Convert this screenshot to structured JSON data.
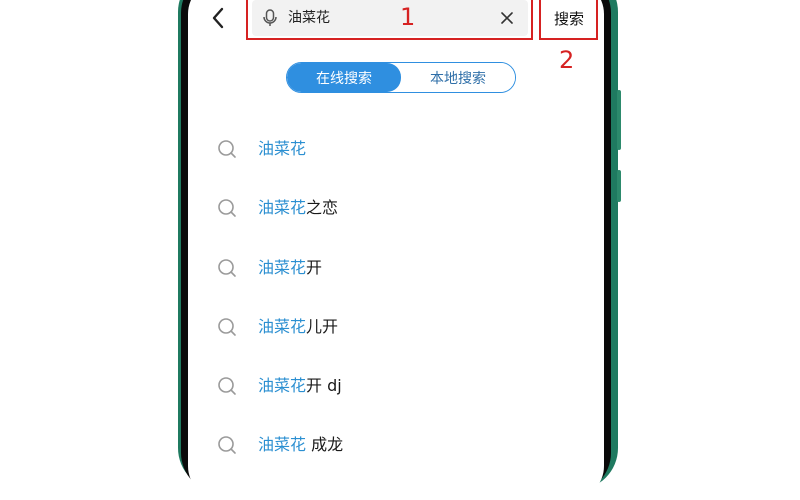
{
  "header": {
    "search_value": "油菜花",
    "search_button_label": "搜索"
  },
  "annotations": {
    "label_1": "1",
    "label_2": "2",
    "box_color": "#d62222"
  },
  "tabs": [
    {
      "label": "在线搜索",
      "active": true
    },
    {
      "label": "本地搜索",
      "active": false
    }
  ],
  "suggestions": [
    {
      "highlight": "油菜花",
      "rest": ""
    },
    {
      "highlight": "油菜花",
      "rest": "之恋"
    },
    {
      "highlight": "油菜花",
      "rest": "开"
    },
    {
      "highlight": "油菜花",
      "rest": "儿开"
    },
    {
      "highlight": "油菜花",
      "rest": "开 dj"
    },
    {
      "highlight": "油菜花",
      "rest": " 成龙"
    }
  ],
  "colors": {
    "accent": "#2f8fe0",
    "highlight_text": "#2b8fd1",
    "phone_frame": "#1f7a60"
  },
  "icons": {
    "back": "chevron-left-icon",
    "mic": "microphone-icon",
    "clear": "close-icon",
    "suggestion": "search-icon"
  }
}
